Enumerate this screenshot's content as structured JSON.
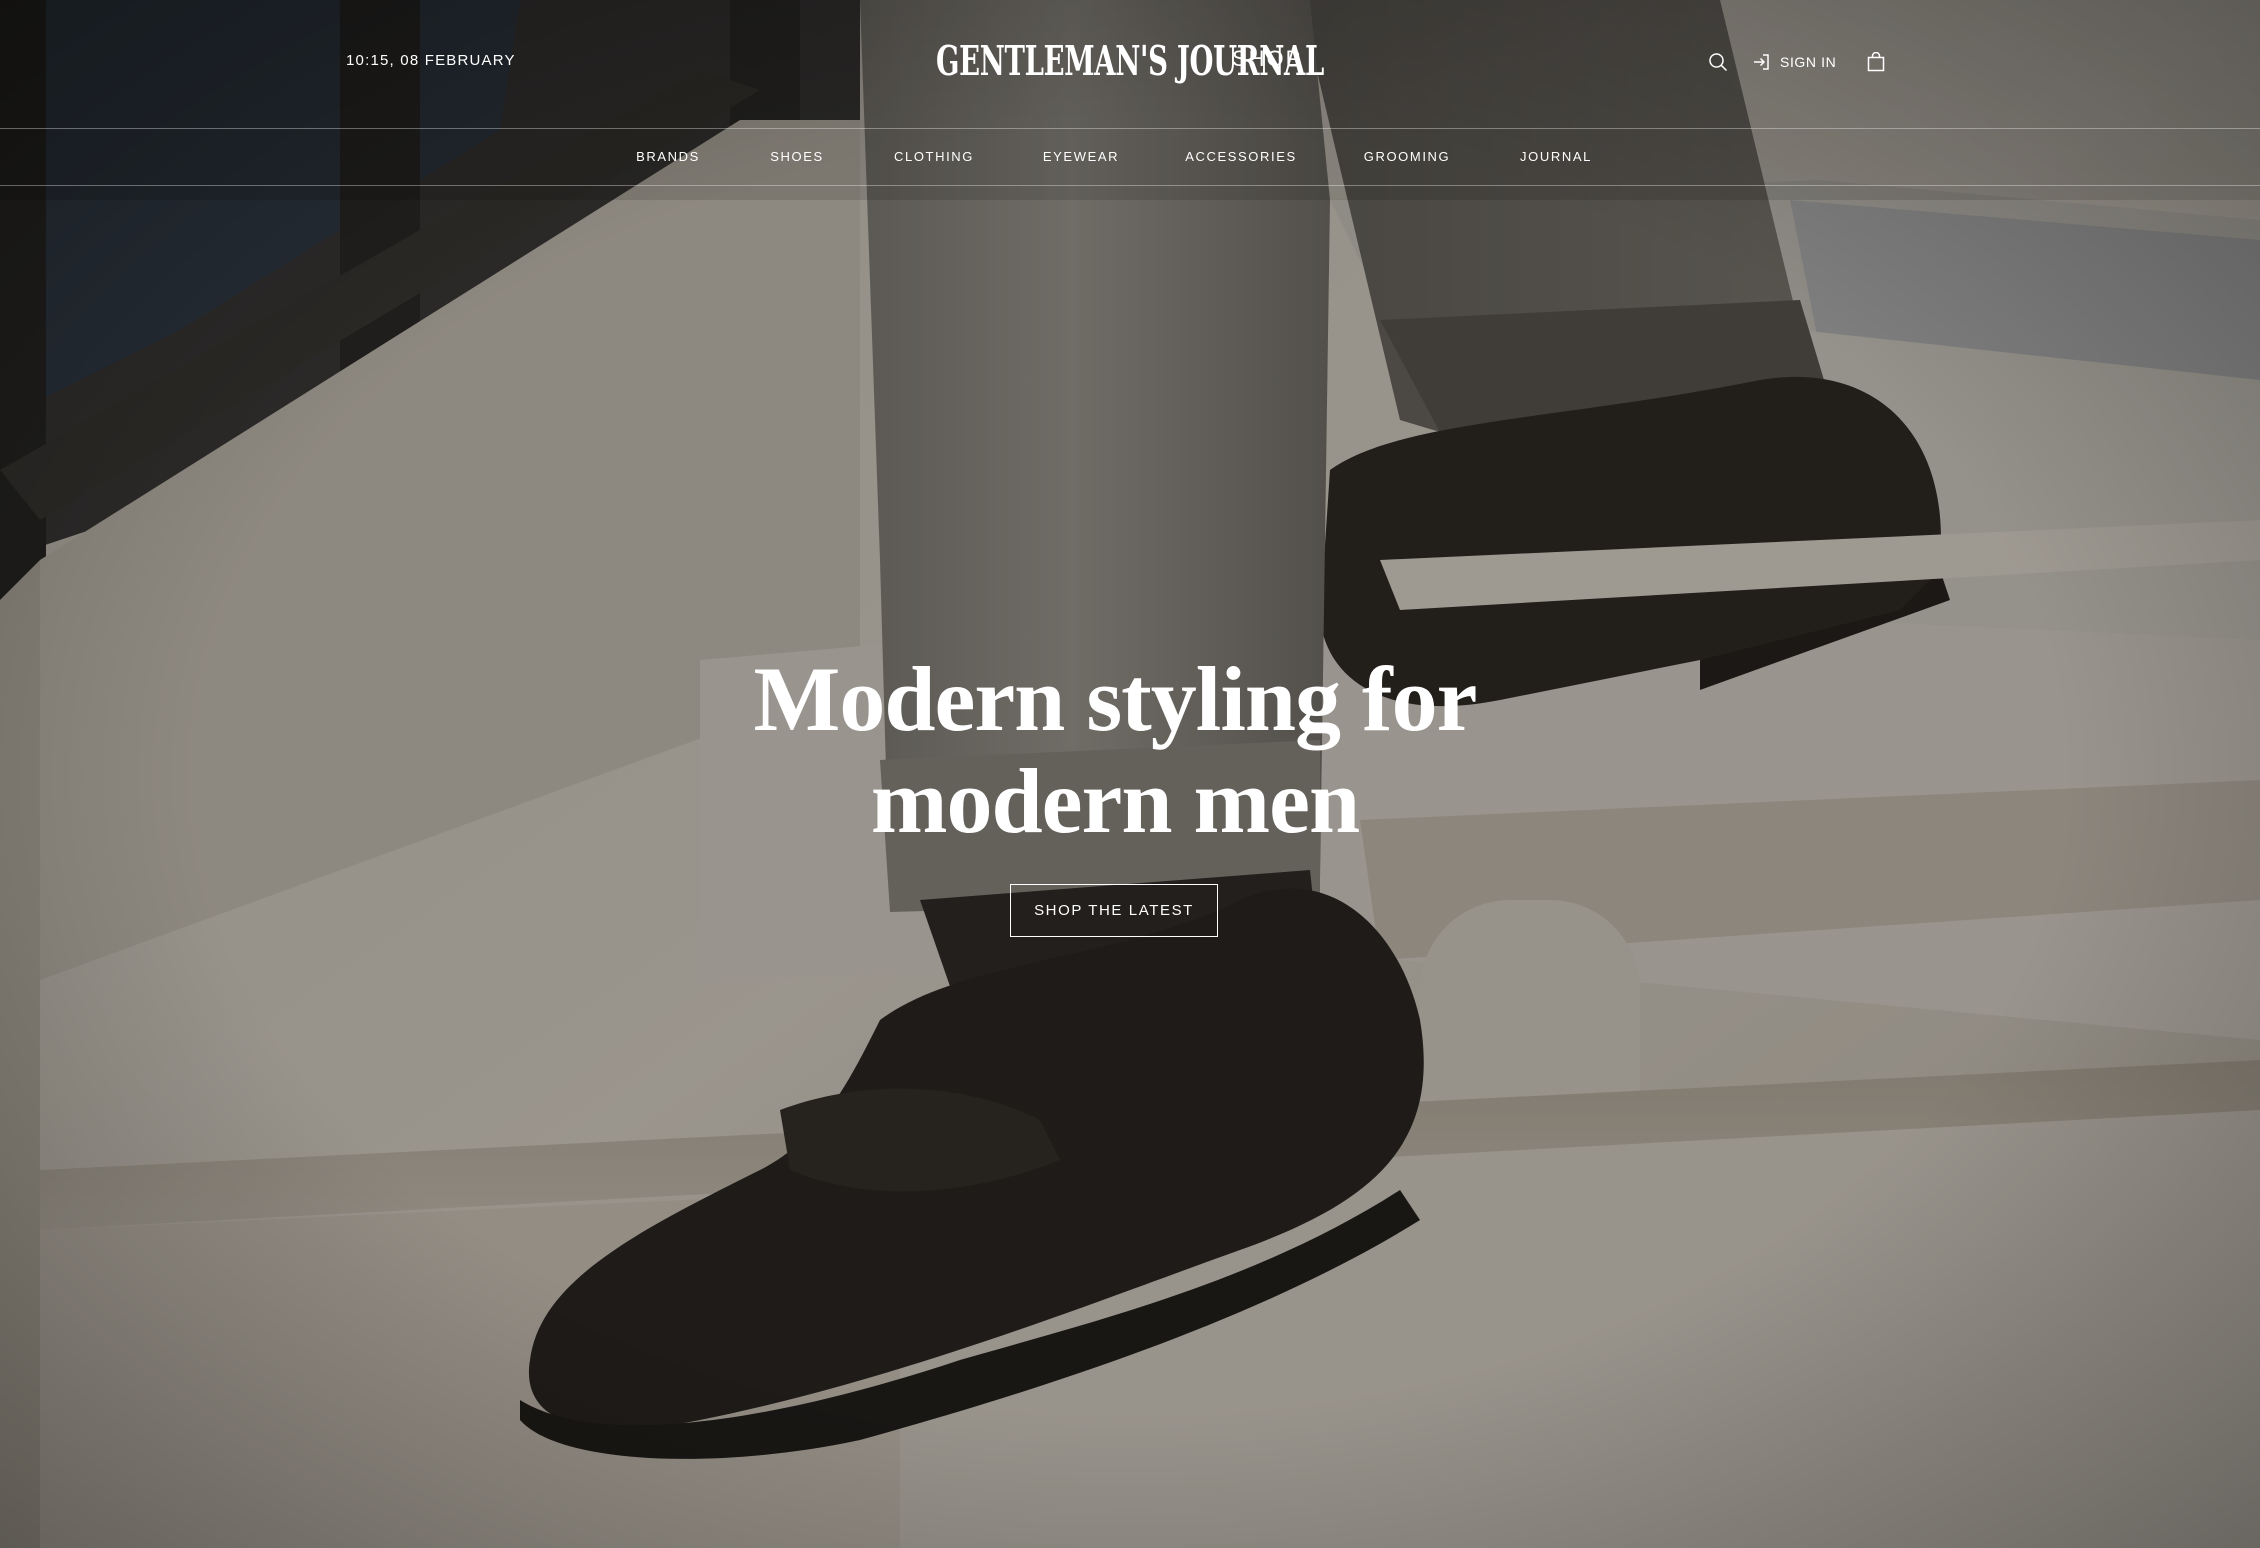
{
  "header": {
    "datetime": "10:15, 08 FEBRUARY",
    "logo_text": "GENTLEMAN'S JOURNAL",
    "logo_suffix": "SHOP",
    "signin_label": "SIGN IN",
    "icons": {
      "search": "search-icon",
      "signin": "sign-in-icon",
      "bag": "shopping-bag-icon"
    }
  },
  "nav": {
    "items": [
      {
        "label": "BRANDS"
      },
      {
        "label": "SHOES"
      },
      {
        "label": "CLOTHING"
      },
      {
        "label": "EYEWEAR"
      },
      {
        "label": "ACCESSORIES"
      },
      {
        "label": "GROOMING"
      },
      {
        "label": "JOURNAL"
      }
    ]
  },
  "hero": {
    "headline_line1": "Modern styling for",
    "headline_line2": "modern men",
    "cta_label": "SHOP THE LATEST"
  },
  "colors": {
    "text": "#ffffff",
    "overlay": "#2e2a25",
    "stone": "#e9e3d8"
  }
}
